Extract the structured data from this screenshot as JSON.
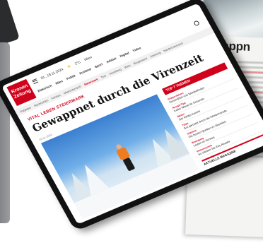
{
  "paper": {
    "headline": "Gewappn"
  },
  "header": {
    "logo_line1": "Kronen",
    "logo_line2": "Zeitung",
    "date": "DI., 19.11.2024",
    "temperature": "2°C",
    "location": "Wien"
  },
  "nav_main": [
    "Elektrisch",
    "Wien",
    "Politik",
    "Ausland",
    "Sport",
    "Adabei",
    "Digital",
    "Video"
  ],
  "nav_sub": [
    "Ratgeber",
    "Nachrichten",
    "Kärnten",
    "Oberösterreich",
    "Steiermark",
    "Tirol",
    "Vorarlberg",
    "Wien",
    "Burgenland",
    "Salzburg",
    "Niederösterreich"
  ],
  "nav_sub_active": 4,
  "article": {
    "kicker": "VITAL LEBEN STEIERMARK",
    "title": "Gewappnet durch die Virenzeit",
    "date": "19.11.2024"
  },
  "sidebar": {
    "heading": "TOP 7 THEMEN",
    "items": [
      {
        "kicker": "Grippe-Saison",
        "text": "Gesundheit und Wohlbefinden"
      },
      {
        "kicker": "Rezept-Tipp",
        "text": "Koller Wiese für Gesunde"
      },
      {
        "kicker": "Wetter",
        "text": "Der Winter kommt"
      },
      {
        "kicker": "Tipps",
        "text": "Gut gerüstet durch die Wintermonate"
      },
      {
        "kicker": "Vitamine",
        "text": "Die besten Quellen im Überblick"
      },
      {
        "kicker": "Bewegung",
        "text": "Laufen im Schnee"
      },
      {
        "kicker": "Immunsystem",
        "text": "So stärken Sie Ihre Abwehr"
      }
    ],
    "footer": "AKTUELLE MAGAZINE"
  },
  "colors": {
    "brand": "#d0021b",
    "jacket": "#f07c1f",
    "sky": "#3b7fd0"
  }
}
